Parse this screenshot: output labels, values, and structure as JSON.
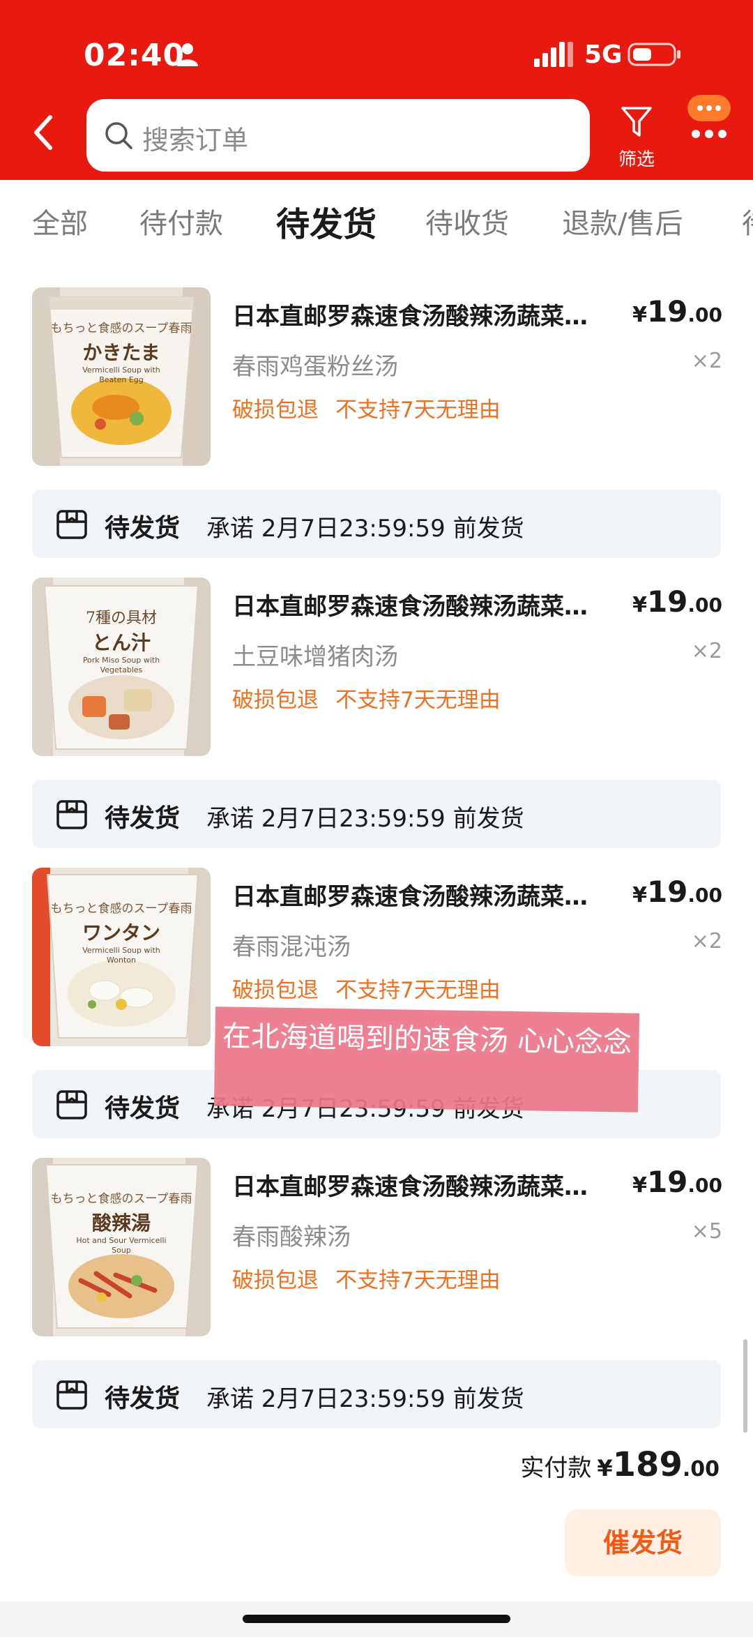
{
  "status_bar": {
    "time": "02:40",
    "network": "5G"
  },
  "search": {
    "placeholder": "搜索订单"
  },
  "filter": {
    "label": "筛选"
  },
  "tabs": [
    {
      "label": "全部"
    },
    {
      "label": "待付款"
    },
    {
      "label": "待发货",
      "active": true
    },
    {
      "label": "待收货"
    },
    {
      "label": "退款/售后"
    },
    {
      "label": "待"
    }
  ],
  "orders": [
    {
      "title": "日本直邮罗森速食汤酸辣汤蔬菜…",
      "price": {
        "currency": "¥",
        "int": "19",
        "dec": ".00"
      },
      "variant": "春雨鸡蛋粉丝汤",
      "qty": "×2",
      "tag1": "破损包退",
      "tag2": "不支持7天无理由",
      "thumb_main": "かきたま",
      "thumb_top": "もちっと食感のスープ春雨",
      "thumb_sub": "Vermicelli Soup with Beaten Egg",
      "ship_status": "待发货",
      "ship_promise": "承诺 2月7日23:59:59 前发货"
    },
    {
      "title": "日本直邮罗森速食汤酸辣汤蔬菜…",
      "price": {
        "currency": "¥",
        "int": "19",
        "dec": ".00"
      },
      "variant": "土豆味增猪肉汤",
      "qty": "×2",
      "tag1": "破损包退",
      "tag2": "不支持7天无理由",
      "thumb_main": "とん汁",
      "thumb_top": "7種の具材",
      "thumb_sub": "Pork Miso Soup with Vegetables",
      "ship_status": "待发货",
      "ship_promise": "承诺 2月7日23:59:59 前发货"
    },
    {
      "title": "日本直邮罗森速食汤酸辣汤蔬菜…",
      "price": {
        "currency": "¥",
        "int": "19",
        "dec": ".00"
      },
      "variant": "春雨混沌汤",
      "qty": "×2",
      "tag1": "破损包退",
      "tag2": "不支持7天无理由",
      "thumb_main": "ワンタン",
      "thumb_top": "もちっと食感のスープ春雨",
      "thumb_sub": "Vermicelli Soup with Wonton",
      "ship_status": "待发货",
      "ship_promise": "承诺 2月7日23:59:59 前发货"
    },
    {
      "title": "日本直邮罗森速食汤酸辣汤蔬菜…",
      "price": {
        "currency": "¥",
        "int": "19",
        "dec": ".00"
      },
      "variant": "春雨酸辣汤",
      "qty": "×5",
      "tag1": "破损包退",
      "tag2": "不支持7天无理由",
      "thumb_main": "酸辣湯",
      "thumb_top": "もちっと食感のスープ春雨",
      "thumb_sub": "Hot and Sour Vermicelli Soup",
      "ship_status": "待发货",
      "ship_promise": "承诺 2月7日23:59:59 前发货"
    }
  ],
  "total": {
    "label": "实付款",
    "currency": "¥",
    "int": "189",
    "dec": ".00"
  },
  "action": {
    "label": "催发货"
  },
  "overlay_caption": "在北海道喝到的速食汤 心心念念",
  "colors": {
    "brand_red": "#e8190f",
    "accent_orange": "#f0701e",
    "button_bg": "#fff0e6",
    "button_text": "#f05a14"
  }
}
